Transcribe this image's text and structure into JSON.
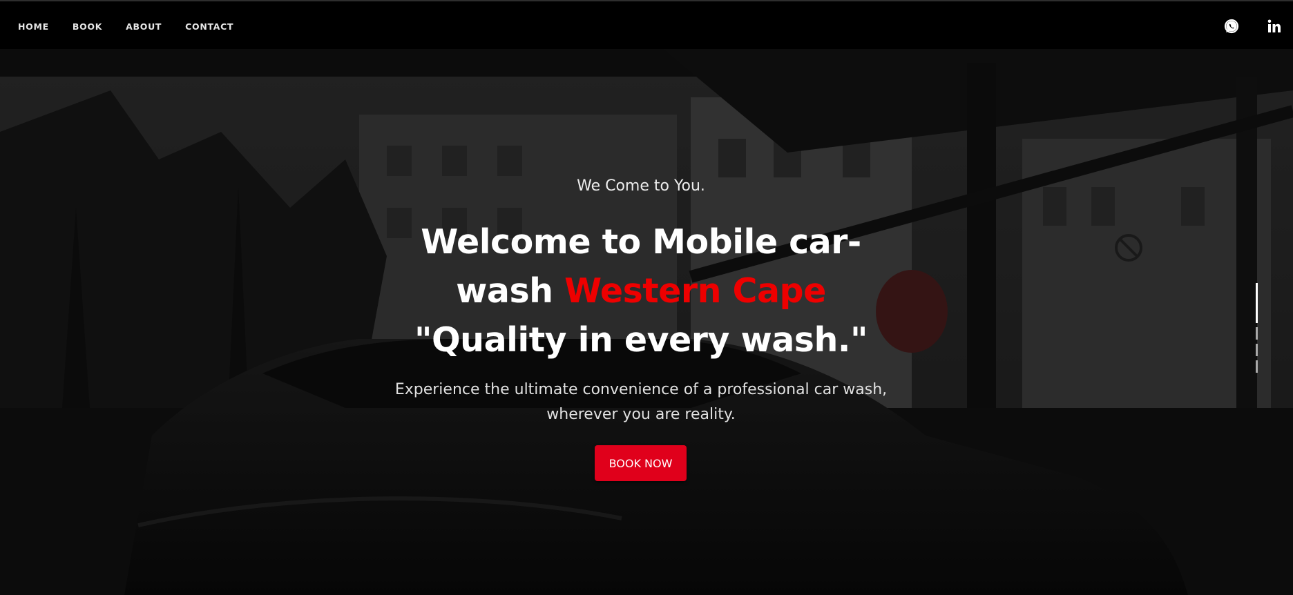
{
  "nav": {
    "items": [
      {
        "label": "HOME"
      },
      {
        "label": "BOOK"
      },
      {
        "label": "ABOUT"
      },
      {
        "label": "CONTACT"
      }
    ]
  },
  "social": {
    "icons": [
      "whatsapp-icon",
      "linkedin-icon"
    ]
  },
  "hero": {
    "kicker": "We Come to  You.",
    "title_line1": "Welcome to Mobile car-",
    "title_line2_prefix": "wash ",
    "title_accent": "Western Cape",
    "title_line3": "\"Quality in every wash.\"",
    "description": "Experience the ultimate convenience of a professional car wash, wherever you are reality.",
    "cta_label": "BOOK NOW"
  },
  "slider": {
    "total": 4,
    "active_index": 0
  },
  "colors": {
    "accent": "#ee0000",
    "button": "#e0001b",
    "navbar": "#000000"
  }
}
